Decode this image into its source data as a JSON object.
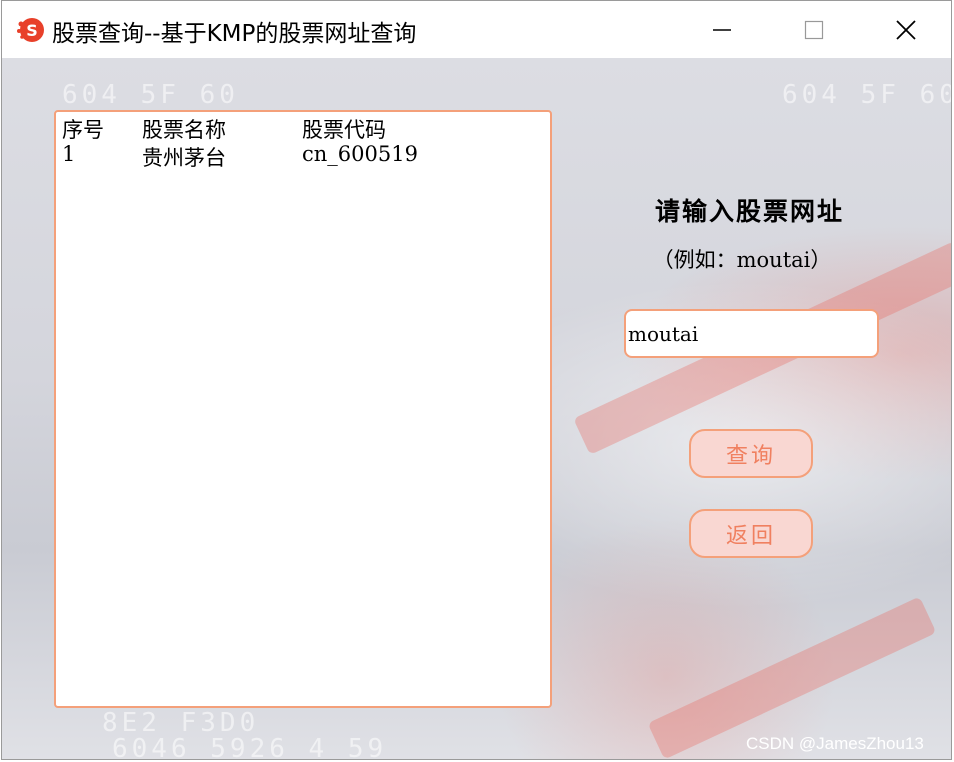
{
  "window": {
    "title": "股票查询--基于KMP的股票网址查询"
  },
  "table": {
    "headers": [
      "序号",
      "股票名称",
      "股票代码"
    ],
    "rows": [
      [
        "1",
        "贵州茅台",
        "cn_600519"
      ]
    ]
  },
  "form": {
    "prompt": "请输入股票网址",
    "example": "（例如：moutai）",
    "input_value": "moutai",
    "query_button": "查询",
    "back_button": "返回"
  },
  "background": {
    "digit_rows": [
      "604 5F 60",
      "8E2 F3D0",
      "6046 5926 4 59"
    ]
  },
  "watermark": "CSDN @JamesZhou13",
  "colors": {
    "accent_border": "#f4a07a",
    "button_fill": "#f9d7d2",
    "button_text": "#f08060",
    "app_icon": "#e8402a"
  },
  "icons": {
    "app": "app-logo-icon",
    "minimize": "minimize-icon",
    "maximize": "maximize-icon",
    "close": "close-icon"
  }
}
